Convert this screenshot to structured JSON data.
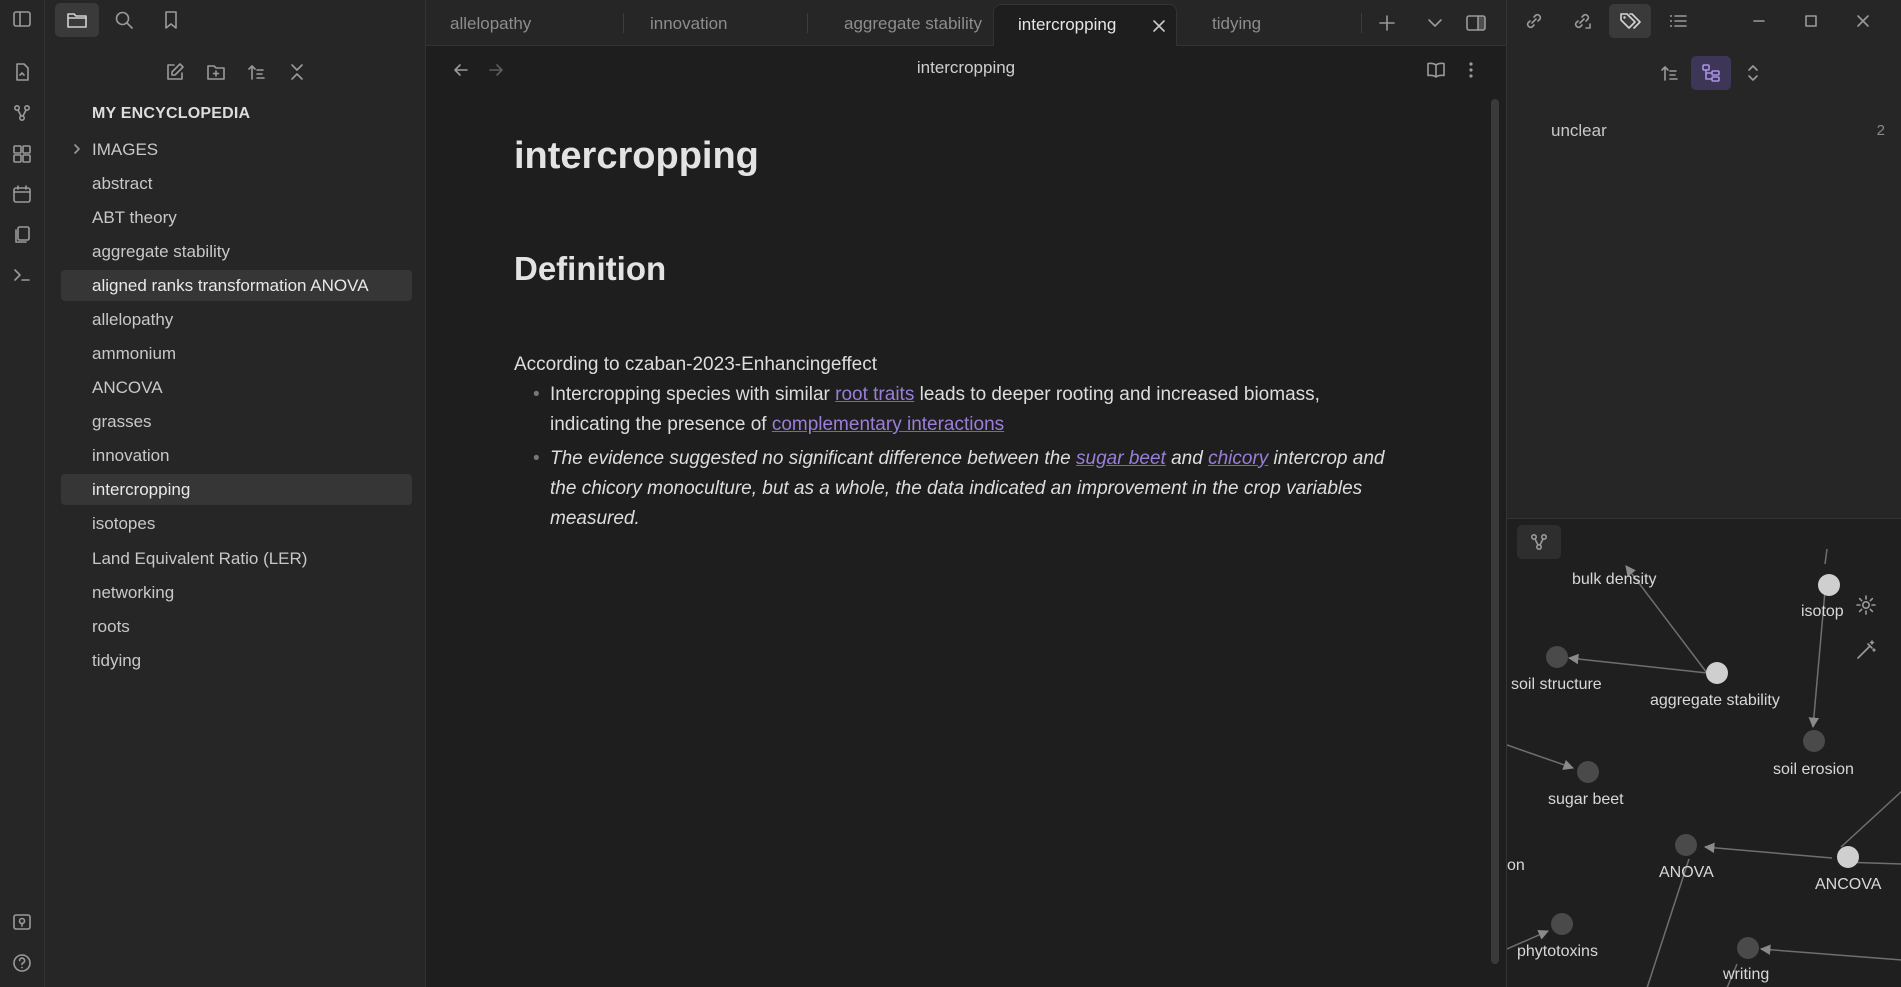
{
  "explorer": {
    "vault_name": "MY ENCYCLOPEDIA",
    "items": [
      {
        "label": "IMAGES",
        "folder": true
      },
      {
        "label": "abstract"
      },
      {
        "label": "ABT theory"
      },
      {
        "label": "aggregate stability"
      },
      {
        "label": "aligned ranks transformation ANOVA",
        "hover": true
      },
      {
        "label": "allelopathy"
      },
      {
        "label": "ammonium"
      },
      {
        "label": "ANCOVA"
      },
      {
        "label": "grasses"
      },
      {
        "label": "innovation"
      },
      {
        "label": "intercropping",
        "active": true
      },
      {
        "label": "isotopes"
      },
      {
        "label": "Land Equivalent Ratio (LER)"
      },
      {
        "label": "networking"
      },
      {
        "label": "roots"
      },
      {
        "label": "tidying"
      }
    ]
  },
  "tabs": [
    {
      "label": "allelopathy"
    },
    {
      "label": "innovation"
    },
    {
      "label": "aggregate stability"
    },
    {
      "label": "intercropping",
      "active": true
    },
    {
      "label": "tidying"
    }
  ],
  "editor": {
    "view_title": "intercropping",
    "title": "intercropping",
    "heading": "Definition",
    "intro": "According to czaban-2023-Enhancingeffect",
    "bullet1": {
      "t1": "Intercropping species with similar ",
      "link1": "root traits",
      "t2": " leads to deeper rooting and increased biomass, indicating the presence of ",
      "link2": "complementary interactions"
    },
    "bullet2": {
      "t1": "The evidence suggested no significant difference between the ",
      "link1": "sugar beet",
      "t2": " and ",
      "link2": "chicory",
      "t3": " intercrop and the chicory monoculture, but as a whole, the data indicated an improvement in the crop variables measured."
    }
  },
  "tag_pane": {
    "tag": "unclear",
    "count": "2"
  },
  "graph": {
    "nodes": [
      {
        "label": "bulk density"
      },
      {
        "label": "isotop"
      },
      {
        "label": "soil structure"
      },
      {
        "label": "aggregate stability"
      },
      {
        "label": "soil erosion"
      },
      {
        "label": "sugar beet"
      },
      {
        "label": "on"
      },
      {
        "label": "ANOVA"
      },
      {
        "label": "ANCOVA"
      },
      {
        "label": "phytotoxins"
      },
      {
        "label": "writing"
      }
    ]
  },
  "colors": {
    "accent": "#9a7fd8",
    "background": "#1e1e1e",
    "sidebar": "#262626"
  }
}
